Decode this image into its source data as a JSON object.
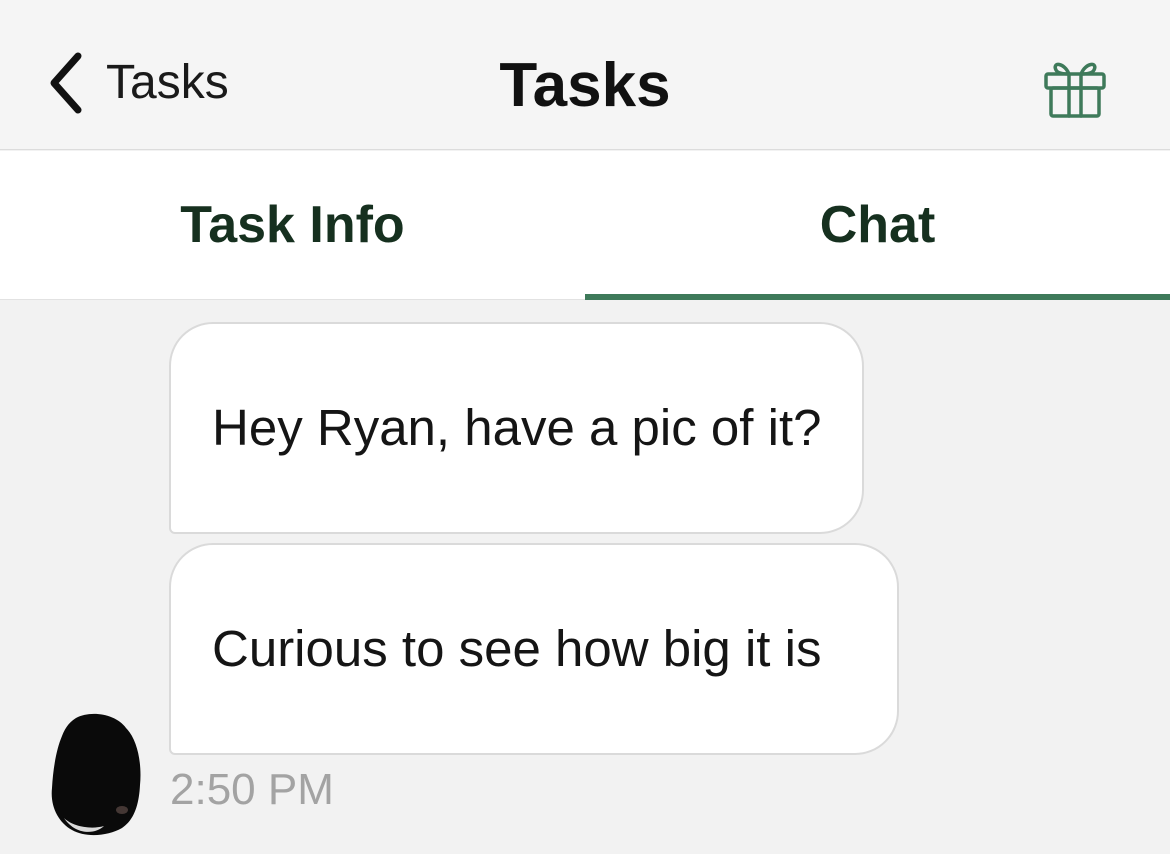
{
  "nav": {
    "back_label": "Tasks",
    "title": "Tasks",
    "icons": {
      "back": "chevron-left-icon",
      "gift": "gift-icon"
    }
  },
  "tabs": [
    {
      "label": "Task Info",
      "active": false
    },
    {
      "label": "Chat",
      "active": true
    }
  ],
  "chat": {
    "messages": [
      {
        "text": "Hey Ryan, have a pic of it?"
      },
      {
        "text": "Curious to see how big it is"
      }
    ],
    "timestamp": "2:50 PM"
  },
  "colors": {
    "accent": "#3e7a5a",
    "tab_text": "#16301f",
    "background": "#f2f2f2",
    "bubble": "#ffffff",
    "timestamp": "#a3a3a3"
  }
}
